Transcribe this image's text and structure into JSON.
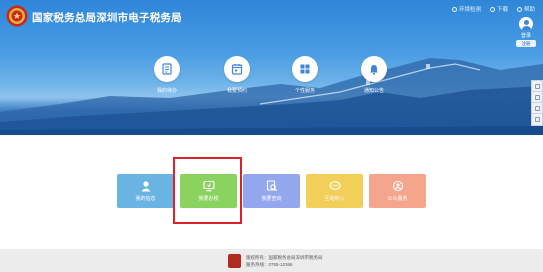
{
  "header": {
    "title": "国家税务总局深圳市电子税务局",
    "links": [
      {
        "label": "环境检测",
        "icon": "monitor-icon"
      },
      {
        "label": "下载",
        "icon": "download-icon"
      },
      {
        "label": "帮助",
        "icon": "help-icon"
      }
    ],
    "login": {
      "label": "登录",
      "sub_label": "注册"
    }
  },
  "quick_menu": [
    {
      "label": "我的待办",
      "icon": "todo-icon"
    },
    {
      "label": "我要预约",
      "icon": "calendar-icon"
    },
    {
      "label": "个性服务",
      "icon": "grid-icon"
    },
    {
      "label": "通知公告",
      "icon": "bell-icon"
    }
  ],
  "service_tiles": [
    {
      "label": "我的信息",
      "icon": "user-icon",
      "color": "#6ab4e4"
    },
    {
      "label": "我要办税",
      "icon": "computer-icon",
      "color": "#8bd35f"
    },
    {
      "label": "我要查询",
      "icon": "search-doc-icon",
      "color": "#93a7ee"
    },
    {
      "label": "互动中心",
      "icon": "chat-icon",
      "color": "#f1cf58"
    },
    {
      "label": "公众服务",
      "icon": "public-service-icon",
      "color": "#f4a58c"
    }
  ],
  "highlighted_tile": "我要办税",
  "footer": {
    "host": "版权所有：国家税务总局深圳市税务局",
    "phone": "服务热线：0755-12366"
  },
  "colors": {
    "banner": "#3b8de0",
    "highlight_border": "#d8232a"
  }
}
